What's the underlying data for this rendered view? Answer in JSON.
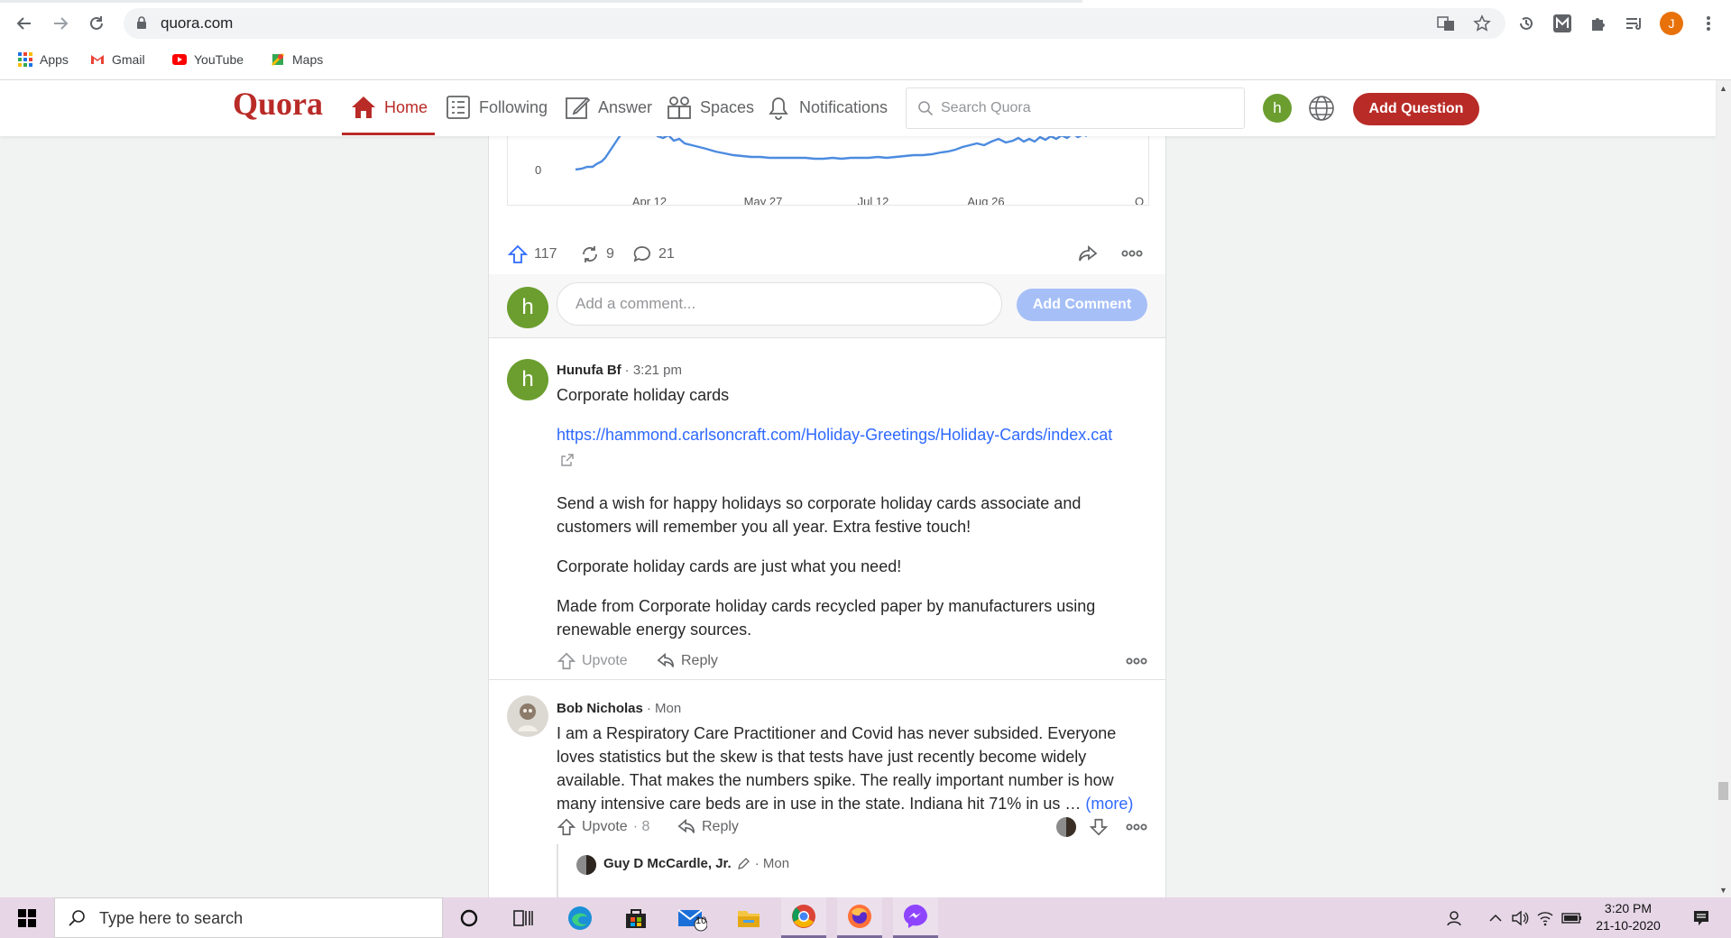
{
  "browser": {
    "url": "quora.com",
    "bookmarks": [
      {
        "label": "Apps"
      },
      {
        "label": "Gmail"
      },
      {
        "label": "YouTube"
      },
      {
        "label": "Maps"
      }
    ],
    "profile_initial": "J"
  },
  "quora": {
    "logo": "Quora",
    "nav": {
      "home": "Home",
      "following": "Following",
      "answer": "Answer",
      "spaces": "Spaces",
      "notifications": "Notifications"
    },
    "search_placeholder": "Search Quora",
    "user_initial": "h",
    "add_question": "Add Question",
    "accent_color": "#b92b27"
  },
  "post": {
    "chart": {
      "y_tick": "0",
      "x_ticks": [
        "Apr 12",
        "May 27",
        "Jul 12",
        "Aug 26",
        "O"
      ]
    },
    "upvotes": "117",
    "shares": "9",
    "comments": "21"
  },
  "comment_box": {
    "avatar_initial": "h",
    "placeholder": "Add a comment...",
    "button": "Add Comment"
  },
  "comments": [
    {
      "author": "Hunufa Bf",
      "time": "· 3:21 pm",
      "avatar_initial": "h",
      "title": "Corporate holiday cards",
      "link": "https://hammond.carlsoncraft.com/Holiday-Greetings/Holiday-Cards/index.cat",
      "paragraphs": [
        "Send a wish for happy holidays so corporate holiday cards associate and customers will remember you all year. Extra festive touch!",
        "Corporate holiday cards are just what you need!",
        "Made from Corporate holiday cards recycled paper by manufacturers using renewable energy sources."
      ],
      "upvote": "Upvote",
      "reply": "Reply"
    },
    {
      "author": "Bob Nicholas",
      "time": "· Mon",
      "text": "I am a Respiratory Care Practitioner and Covid has never subsided. Everyone loves statistics but the skew is that tests have just recently become widely available. That makes the numbers spike. The really important number is how many intensive care beds are in use in the state. Indiana hit 71% in us …",
      "more": "(more)",
      "upvote": "Upvote",
      "upvote_count": "· 8",
      "reply": "Reply"
    }
  ],
  "reply": {
    "author": "Guy D McCardle, Jr.",
    "time": "· Mon"
  },
  "taskbar": {
    "search_placeholder": "Type here to search",
    "mail_badge": "10",
    "time": "3:20 PM",
    "date": "21-10-2020"
  }
}
